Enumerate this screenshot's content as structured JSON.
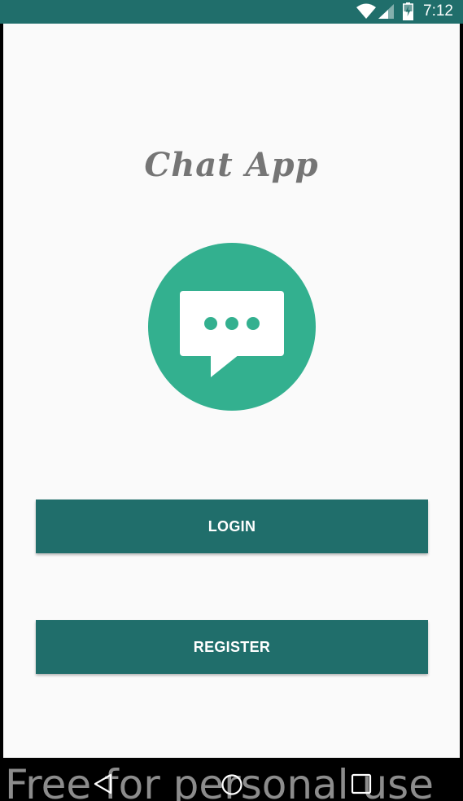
{
  "status_bar": {
    "time": "7:12",
    "background_color": "#206e6b",
    "icons": [
      "wifi-icon",
      "cell-signal-icon",
      "battery-icon"
    ]
  },
  "app": {
    "title": "Chat App",
    "logo_icon": "chat-bubble-icon",
    "logo_color": "#33b08f"
  },
  "buttons": {
    "login_label": "LOGIN",
    "register_label": "REGISTER",
    "color": "#206e6b"
  },
  "nav_bar": {
    "icons": [
      "back-icon",
      "home-icon",
      "recents-icon"
    ]
  },
  "watermark": {
    "text": "Free for personal use"
  }
}
